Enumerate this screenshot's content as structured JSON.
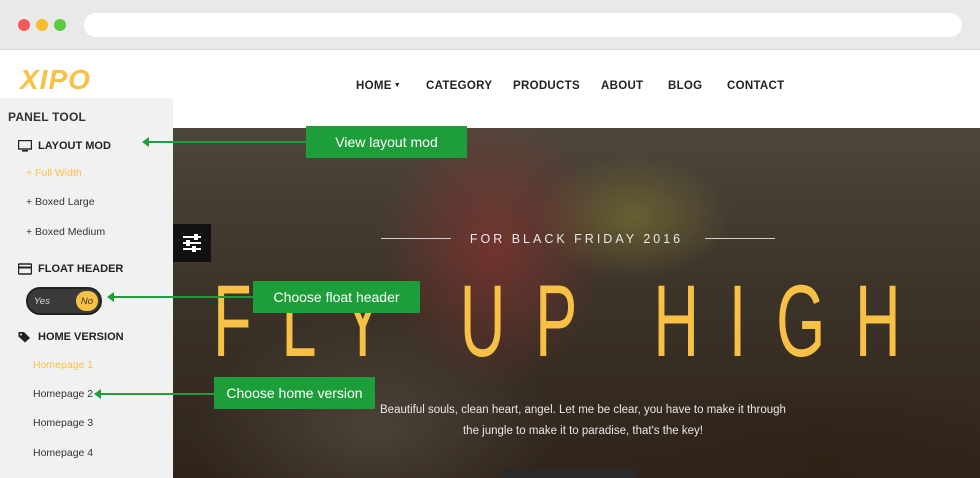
{
  "site": {
    "logo": "XIPO",
    "nav": [
      {
        "label": "HOME",
        "has_dropdown": true
      },
      {
        "label": "CATEGORY"
      },
      {
        "label": "PRODUCTS"
      },
      {
        "label": "ABOUT"
      },
      {
        "label": "BLOG"
      },
      {
        "label": "CONTACT"
      }
    ],
    "accent_color": "#f8c146"
  },
  "hero": {
    "subtitle": "FOR BLACK FRIDAY 2016",
    "title": "FLY UP HIGH",
    "text_line1": "Beautiful souls, clean heart, angel. Let me be clear, you have to make it through",
    "text_line2": "the jungle to make it to paradise, that's the key!"
  },
  "panel": {
    "title": "PANEL TOOL",
    "layout_mod": {
      "label": "LAYOUT MOD",
      "icon": "monitor-icon",
      "options": [
        "+ Full Width",
        "+ Boxed Large",
        "+ Boxed Medium"
      ],
      "active_index": 0
    },
    "float_header": {
      "label": "FLOAT HEADER",
      "icon": "card-icon",
      "yes": "Yes",
      "no": "No",
      "selected": "No"
    },
    "home_version": {
      "label": "HOME VERSION",
      "icon": "tags-icon",
      "options": [
        "Homepage 1",
        "Homepage 2",
        "Homepage 3",
        "Homepage 4"
      ],
      "active_index": 0
    }
  },
  "annotations": {
    "layout": "View layout mod",
    "float": "Choose float header",
    "home": "Choose home version",
    "color": "#1e9e3a"
  }
}
